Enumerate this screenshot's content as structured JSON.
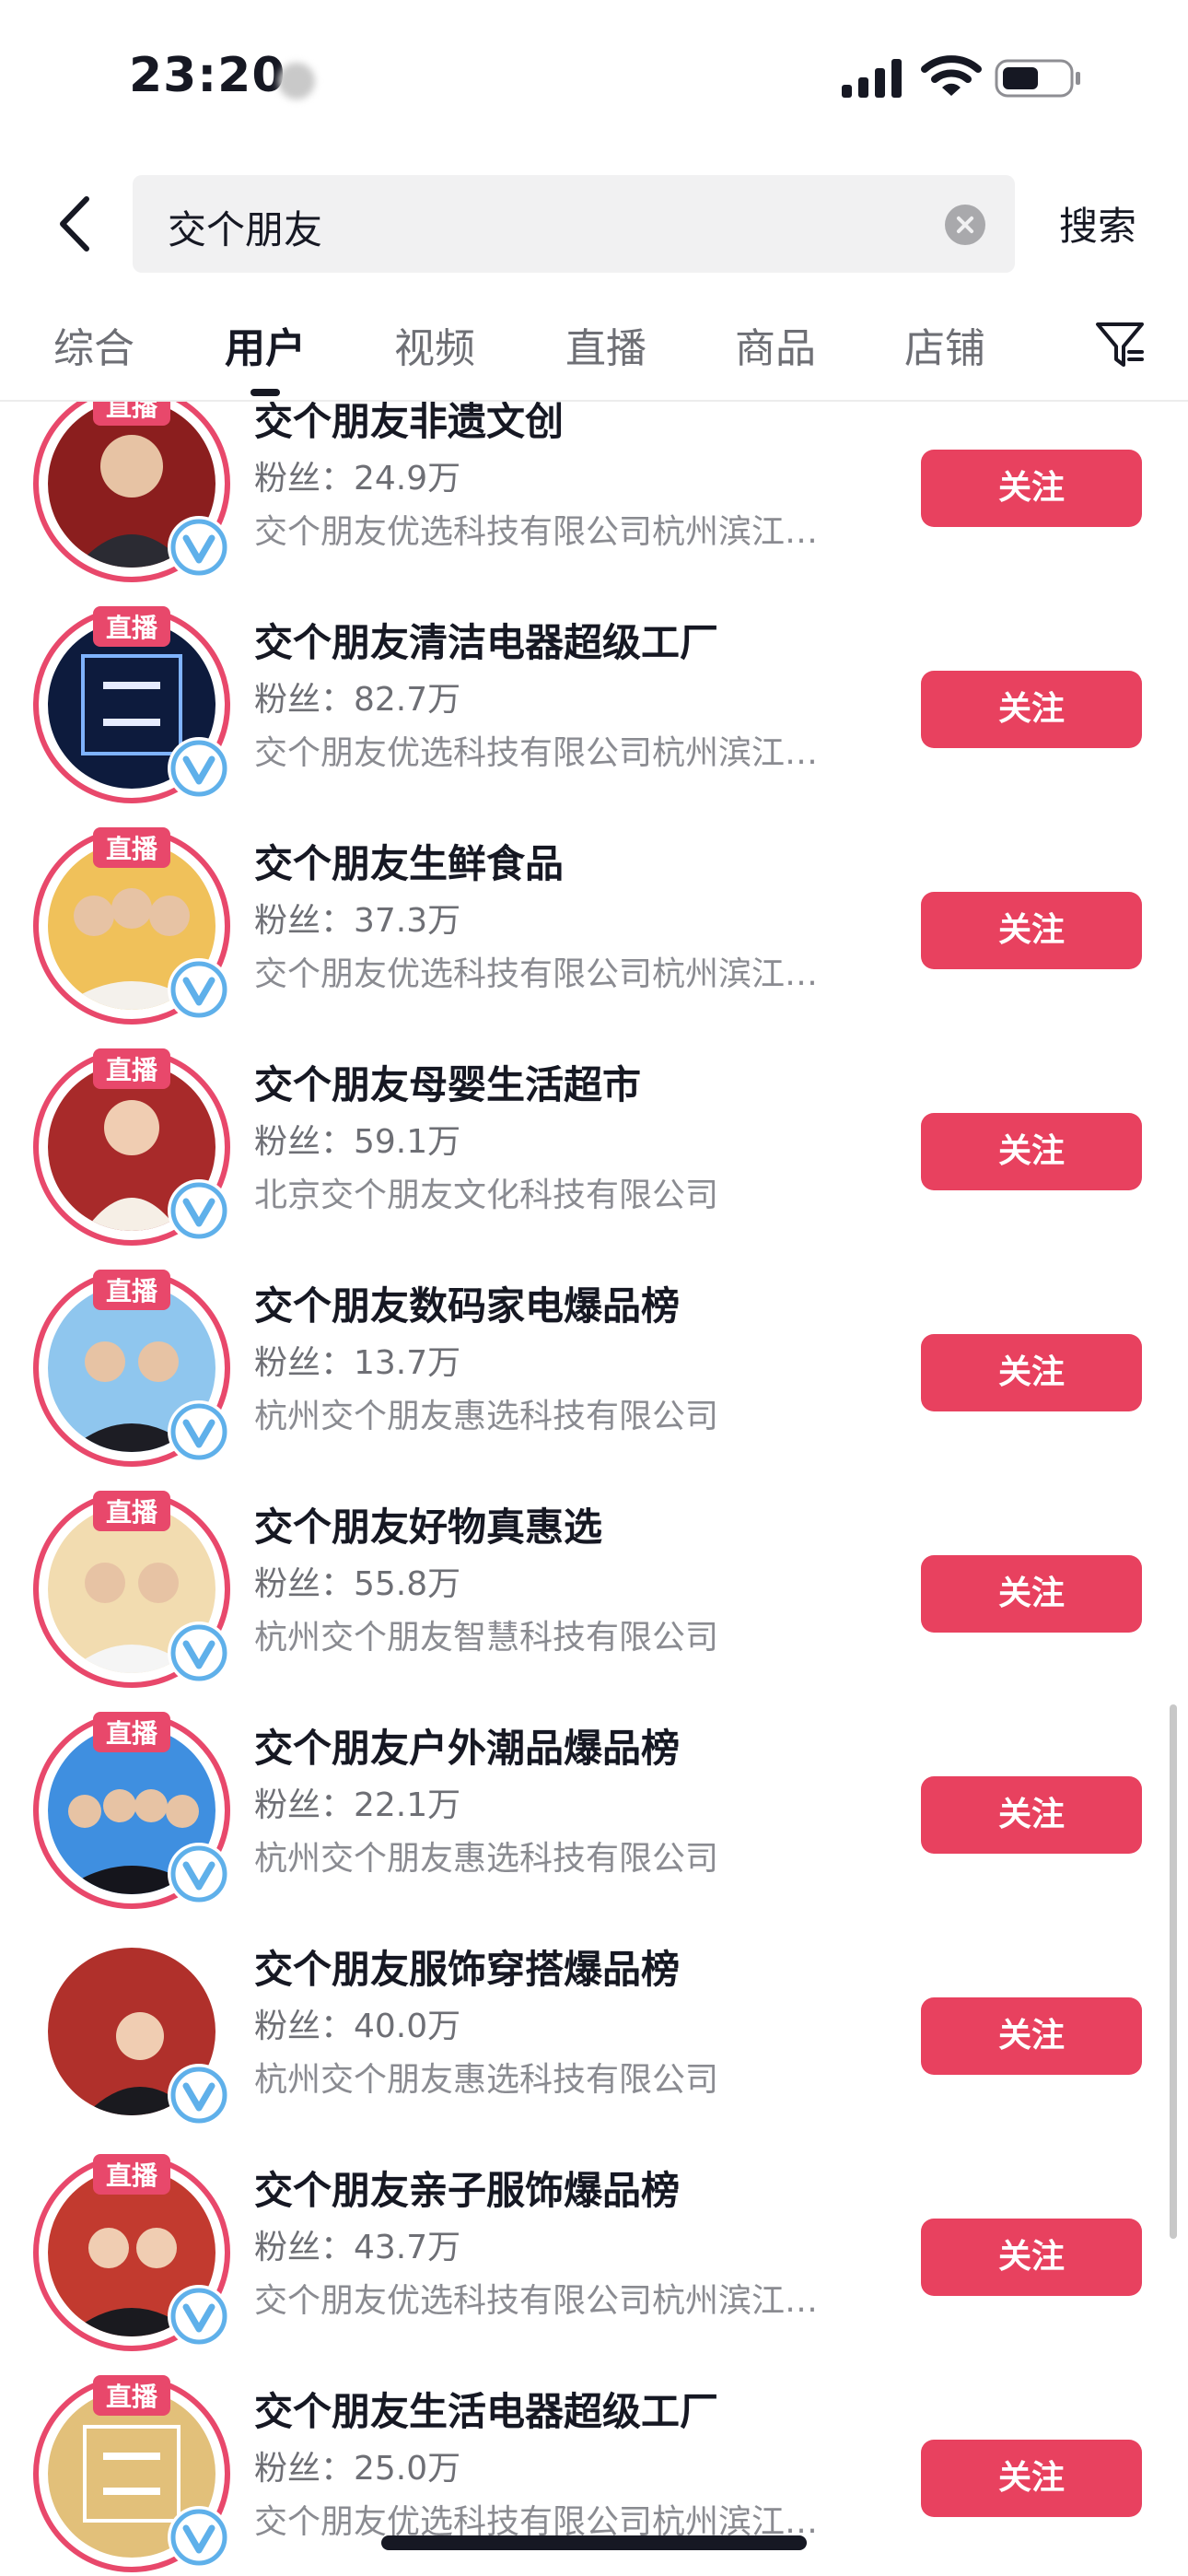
{
  "status_bar": {
    "time": "23:20"
  },
  "search": {
    "query": "交个朋友",
    "submit_label": "搜索"
  },
  "tabs": [
    {
      "label": "综合",
      "active": false
    },
    {
      "label": "用户",
      "active": true
    },
    {
      "label": "视频",
      "active": false
    },
    {
      "label": "直播",
      "active": false
    },
    {
      "label": "商品",
      "active": false
    },
    {
      "label": "店铺",
      "active": false
    }
  ],
  "live_badge": "直播",
  "follow_label": "关注",
  "colors": {
    "accent": "#e8415f",
    "live_ring": "#e8486b",
    "verified": "#5fb0ea"
  },
  "users": [
    {
      "name": "交个朋友非遗文创",
      "fans": "粉丝：24.9万",
      "org": "交个朋友优选科技有限公司杭州滨江…",
      "live": true,
      "avatar_bg": "#8b1e1e"
    },
    {
      "name": "交个朋友清洁电器超级工厂",
      "fans": "粉丝：82.7万",
      "org": "交个朋友优选科技有限公司杭州滨江…",
      "live": true,
      "avatar_bg": "#0d1b3d"
    },
    {
      "name": "交个朋友生鲜食品",
      "fans": "粉丝：37.3万",
      "org": "交个朋友优选科技有限公司杭州滨江…",
      "live": true,
      "avatar_bg": "#f0c15a"
    },
    {
      "name": "交个朋友母婴生活超市",
      "fans": "粉丝：59.1万",
      "org": "北京交个朋友文化科技有限公司",
      "live": true,
      "avatar_bg": "#a82a2a"
    },
    {
      "name": "交个朋友数码家电爆品榜",
      "fans": "粉丝：13.7万",
      "org": "杭州交个朋友惠选科技有限公司",
      "live": true,
      "avatar_bg": "#8fc6ee"
    },
    {
      "name": "交个朋友好物真惠选",
      "fans": "粉丝：55.8万",
      "org": "杭州交个朋友智慧科技有限公司",
      "live": true,
      "avatar_bg": "#f2dcb0"
    },
    {
      "name": "交个朋友户外潮品爆品榜",
      "fans": "粉丝：22.1万",
      "org": "杭州交个朋友惠选科技有限公司",
      "live": true,
      "avatar_bg": "#3f8fe0"
    },
    {
      "name": "交个朋友服饰穿搭爆品榜",
      "fans": "粉丝：40.0万",
      "org": "杭州交个朋友惠选科技有限公司",
      "live": false,
      "avatar_bg": "#b0302b"
    },
    {
      "name": "交个朋友亲子服饰爆品榜",
      "fans": "粉丝：43.7万",
      "org": "交个朋友优选科技有限公司杭州滨江…",
      "live": true,
      "avatar_bg": "#c23a2f"
    },
    {
      "name": "交个朋友生活电器超级工厂",
      "fans": "粉丝：25.0万",
      "org": "交个朋友优选科技有限公司杭州滨江…",
      "live": true,
      "avatar_bg": "#e2c07a"
    }
  ]
}
